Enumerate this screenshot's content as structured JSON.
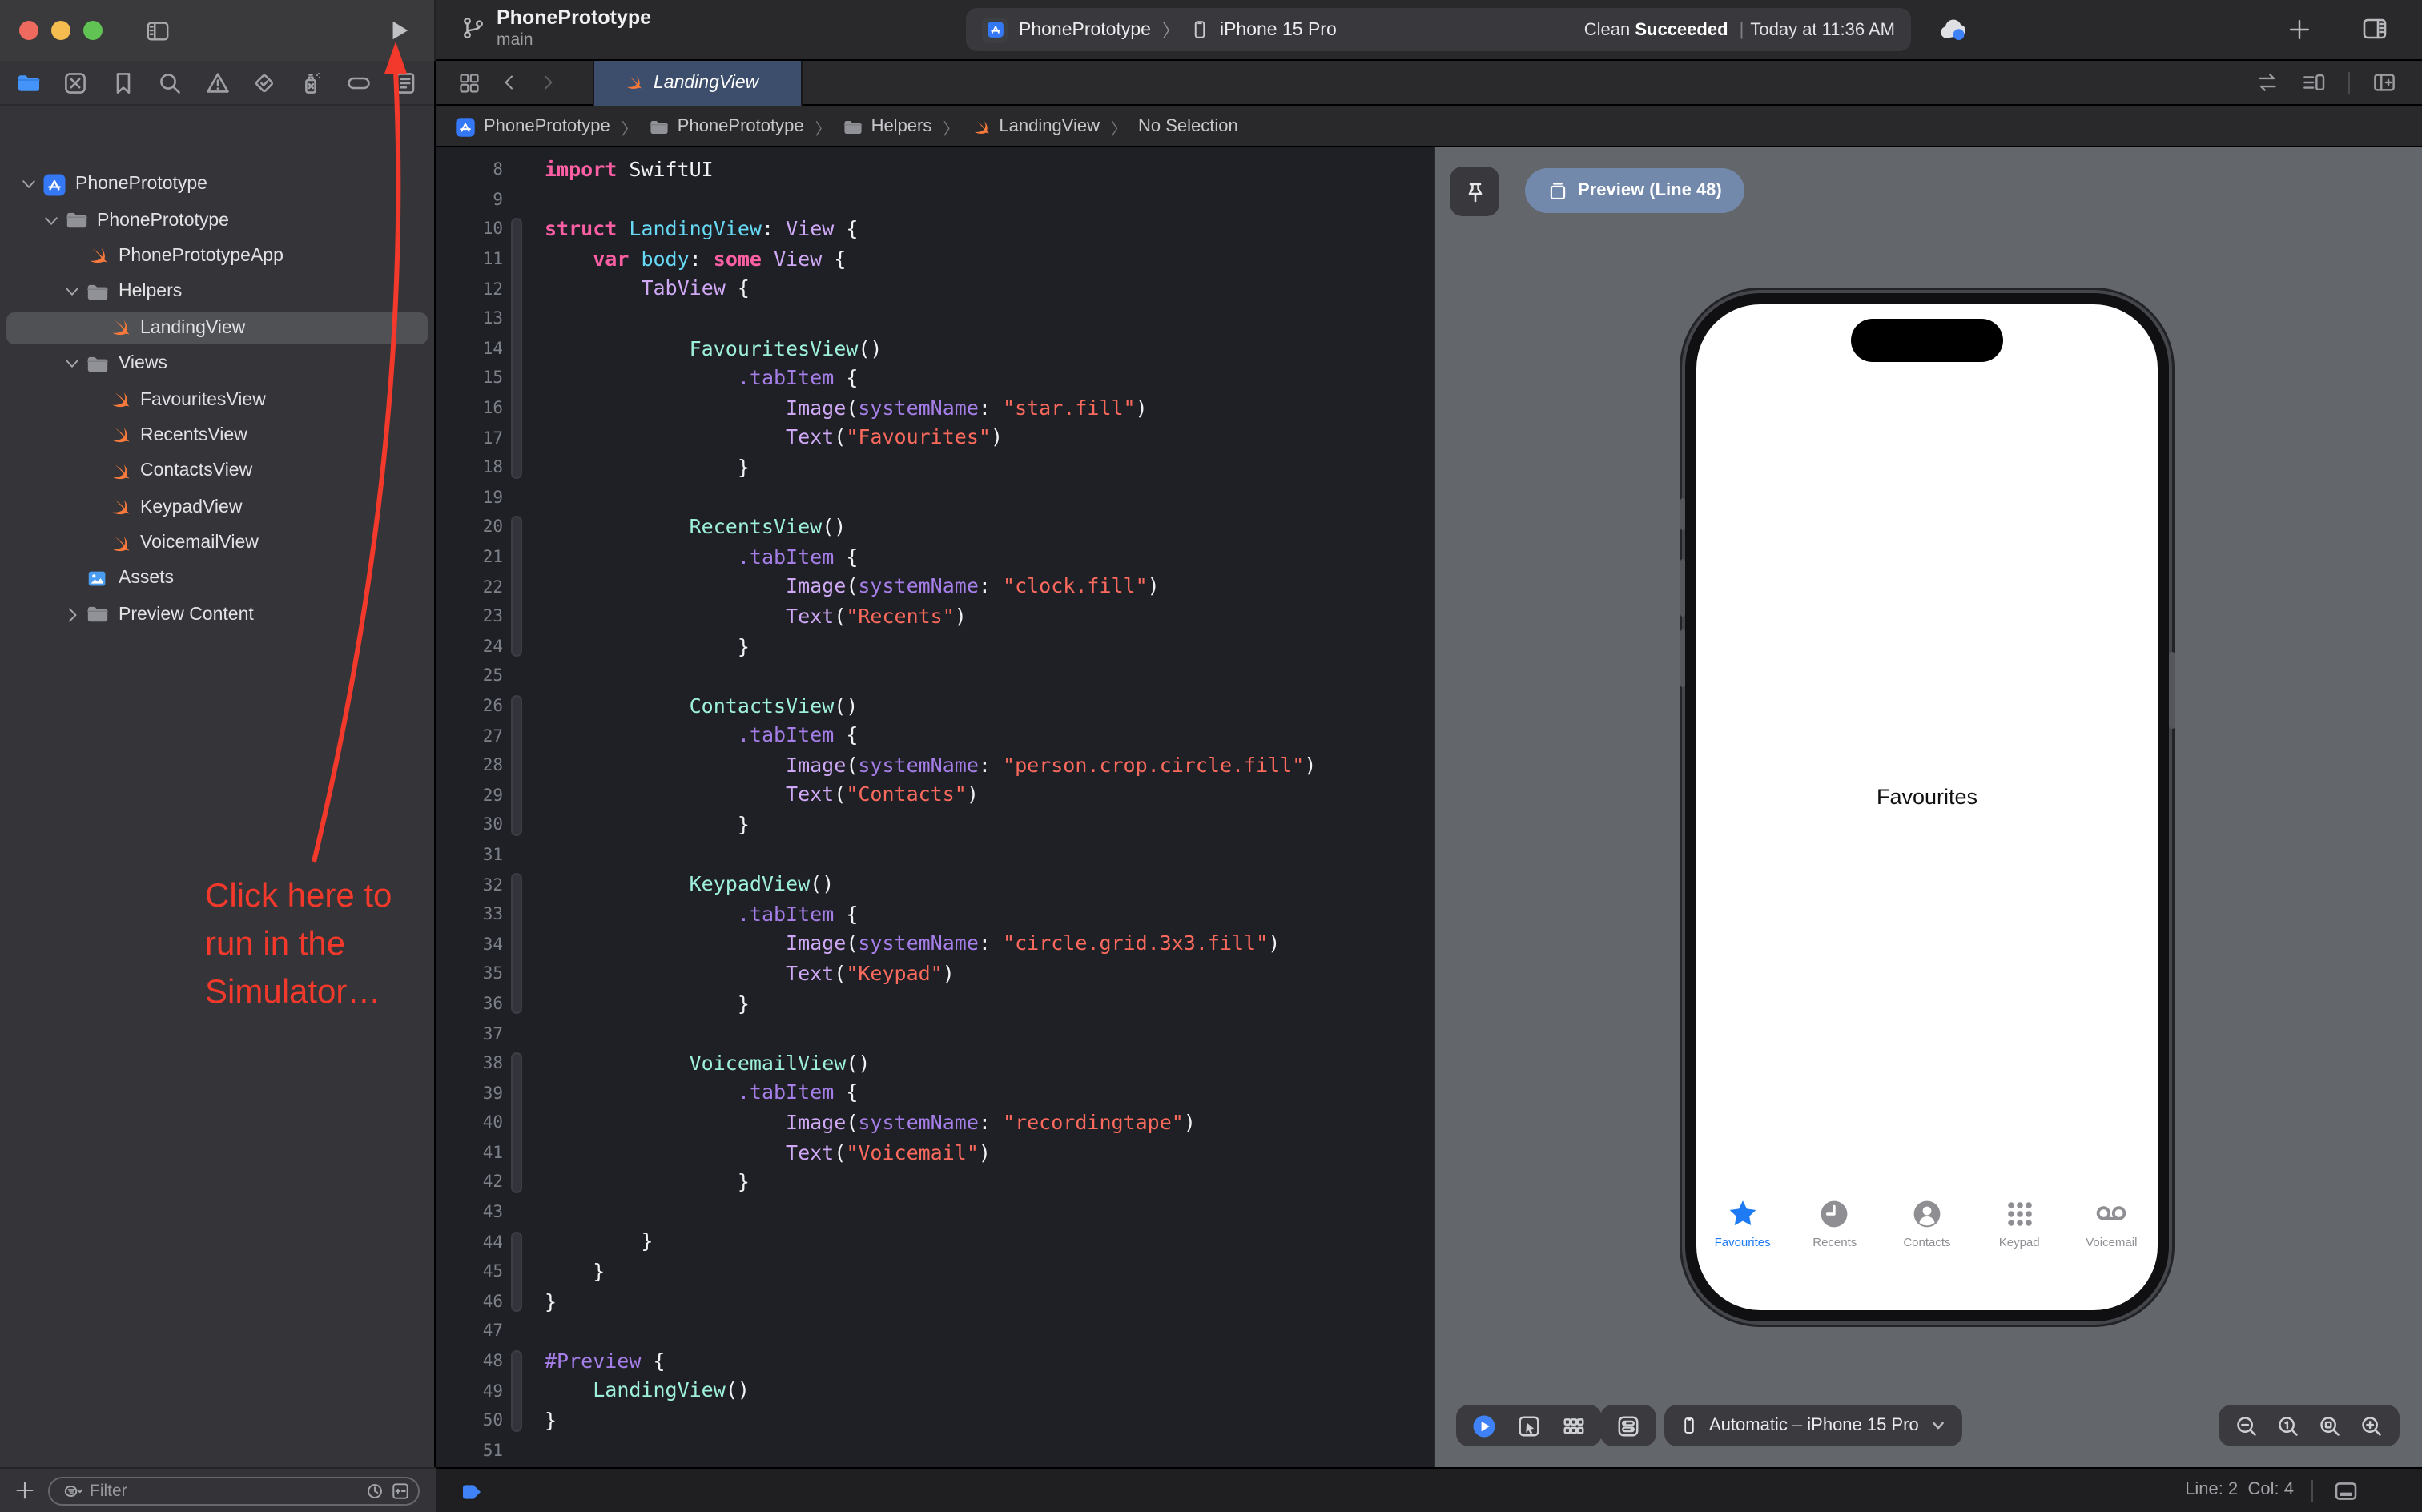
{
  "window": {
    "title": "PhonePrototype",
    "branch": "main"
  },
  "toolbar": {
    "scheme_target": "PhonePrototype",
    "scheme_device": "iPhone 15 Pro",
    "status_action": "Clean",
    "status_result": "Succeeded",
    "status_sep": "|",
    "status_detail": "Today at 11:36 AM"
  },
  "tabs": {
    "active_tab": "LandingView"
  },
  "jumpbar": {
    "items": [
      {
        "icon": "appbadge",
        "label": "PhonePrototype"
      },
      {
        "icon": "folder",
        "label": "PhonePrototype"
      },
      {
        "icon": "folder",
        "label": "Helpers"
      },
      {
        "icon": "swift",
        "label": "LandingView"
      },
      {
        "icon": null,
        "label": "No Selection"
      }
    ]
  },
  "navigator": {
    "tabs": [
      "folder",
      "xsquare",
      "bookmark",
      "search",
      "warning",
      "testdiamond",
      "spray",
      "capsule",
      "reportlist"
    ],
    "active_tab_index": 0,
    "tree": [
      {
        "label": "PhonePrototype",
        "icon": "appbadge",
        "level": 0,
        "disclosure": "down",
        "selected": false
      },
      {
        "label": "PhonePrototype",
        "icon": "folder",
        "level": 1,
        "disclosure": "down",
        "selected": false
      },
      {
        "label": "PhonePrototypeApp",
        "icon": "swift",
        "level": 2,
        "disclosure": null,
        "selected": false
      },
      {
        "label": "Helpers",
        "icon": "folder",
        "level": 2,
        "disclosure": "down",
        "selected": false
      },
      {
        "label": "LandingView",
        "icon": "swift",
        "level": 3,
        "disclosure": null,
        "selected": true
      },
      {
        "label": "Views",
        "icon": "folder",
        "level": 2,
        "disclosure": "down",
        "selected": false
      },
      {
        "label": "FavouritesView",
        "icon": "swift",
        "level": 3,
        "disclosure": null,
        "selected": false
      },
      {
        "label": "RecentsView",
        "icon": "swift",
        "level": 3,
        "disclosure": null,
        "selected": false
      },
      {
        "label": "ContactsView",
        "icon": "swift",
        "level": 3,
        "disclosure": null,
        "selected": false
      },
      {
        "label": "KeypadView",
        "icon": "swift",
        "level": 3,
        "disclosure": null,
        "selected": false
      },
      {
        "label": "VoicemailView",
        "icon": "swift",
        "level": 3,
        "disclosure": null,
        "selected": false
      },
      {
        "label": "Assets",
        "icon": "assets",
        "level": 2,
        "disclosure": null,
        "selected": false
      },
      {
        "label": "Preview Content",
        "icon": "folder",
        "level": 2,
        "disclosure": "right",
        "selected": false
      }
    ],
    "filter_placeholder": "Filter"
  },
  "editor": {
    "lines": [
      {
        "n": 8,
        "seg": [
          [
            "k",
            "import"
          ],
          [
            "w",
            " SwiftUI"
          ]
        ]
      },
      {
        "n": 9,
        "seg": []
      },
      {
        "n": 10,
        "seg": [
          [
            "k",
            "struct"
          ],
          [
            "w",
            " "
          ],
          [
            "c",
            "LandingView"
          ],
          [
            "w",
            ": "
          ],
          [
            "t",
            "View"
          ],
          [
            "w",
            " {"
          ]
        ]
      },
      {
        "n": 11,
        "seg": [
          [
            "w",
            "    "
          ],
          [
            "k",
            "var"
          ],
          [
            "w",
            " "
          ],
          [
            "c",
            "body"
          ],
          [
            "w",
            ": "
          ],
          [
            "k",
            "some"
          ],
          [
            "w",
            " "
          ],
          [
            "t",
            "View"
          ],
          [
            "w",
            " {"
          ]
        ]
      },
      {
        "n": 12,
        "seg": [
          [
            "w",
            "        "
          ],
          [
            "t",
            "TabView"
          ],
          [
            "w",
            " {"
          ]
        ]
      },
      {
        "n": 13,
        "seg": []
      },
      {
        "n": 14,
        "seg": [
          [
            "w",
            "            "
          ],
          [
            "m",
            "FavouritesView"
          ],
          [
            "w",
            "()"
          ]
        ]
      },
      {
        "n": 15,
        "seg": [
          [
            "w",
            "                "
          ],
          [
            "f",
            ".tabItem"
          ],
          [
            "w",
            " {"
          ]
        ]
      },
      {
        "n": 16,
        "seg": [
          [
            "w",
            "                    "
          ],
          [
            "t",
            "Image"
          ],
          [
            "w",
            "("
          ],
          [
            "f",
            "systemName"
          ],
          [
            "w",
            ": "
          ],
          [
            "s",
            "\"star.fill\""
          ],
          [
            "w",
            ")"
          ]
        ]
      },
      {
        "n": 17,
        "seg": [
          [
            "w",
            "                    "
          ],
          [
            "t",
            "Text"
          ],
          [
            "w",
            "("
          ],
          [
            "s",
            "\"Favourites\""
          ],
          [
            "w",
            ")"
          ]
        ]
      },
      {
        "n": 18,
        "seg": [
          [
            "w",
            "                }"
          ]
        ]
      },
      {
        "n": 19,
        "seg": []
      },
      {
        "n": 20,
        "seg": [
          [
            "w",
            "            "
          ],
          [
            "m",
            "RecentsView"
          ],
          [
            "w",
            "()"
          ]
        ]
      },
      {
        "n": 21,
        "seg": [
          [
            "w",
            "                "
          ],
          [
            "f",
            ".tabItem"
          ],
          [
            "w",
            " {"
          ]
        ]
      },
      {
        "n": 22,
        "seg": [
          [
            "w",
            "                    "
          ],
          [
            "t",
            "Image"
          ],
          [
            "w",
            "("
          ],
          [
            "f",
            "systemName"
          ],
          [
            "w",
            ": "
          ],
          [
            "s",
            "\"clock.fill\""
          ],
          [
            "w",
            ")"
          ]
        ]
      },
      {
        "n": 23,
        "seg": [
          [
            "w",
            "                    "
          ],
          [
            "t",
            "Text"
          ],
          [
            "w",
            "("
          ],
          [
            "s",
            "\"Recents\""
          ],
          [
            "w",
            ")"
          ]
        ]
      },
      {
        "n": 24,
        "seg": [
          [
            "w",
            "                }"
          ]
        ]
      },
      {
        "n": 25,
        "seg": []
      },
      {
        "n": 26,
        "seg": [
          [
            "w",
            "            "
          ],
          [
            "m",
            "ContactsView"
          ],
          [
            "w",
            "()"
          ]
        ]
      },
      {
        "n": 27,
        "seg": [
          [
            "w",
            "                "
          ],
          [
            "f",
            ".tabItem"
          ],
          [
            "w",
            " {"
          ]
        ]
      },
      {
        "n": 28,
        "seg": [
          [
            "w",
            "                    "
          ],
          [
            "t",
            "Image"
          ],
          [
            "w",
            "("
          ],
          [
            "f",
            "systemName"
          ],
          [
            "w",
            ": "
          ],
          [
            "s",
            "\"person.crop.circle.fill\""
          ],
          [
            "w",
            ")"
          ]
        ]
      },
      {
        "n": 29,
        "seg": [
          [
            "w",
            "                    "
          ],
          [
            "t",
            "Text"
          ],
          [
            "w",
            "("
          ],
          [
            "s",
            "\"Contacts\""
          ],
          [
            "w",
            ")"
          ]
        ]
      },
      {
        "n": 30,
        "seg": [
          [
            "w",
            "                }"
          ]
        ]
      },
      {
        "n": 31,
        "seg": []
      },
      {
        "n": 32,
        "seg": [
          [
            "w",
            "            "
          ],
          [
            "m",
            "KeypadView"
          ],
          [
            "w",
            "()"
          ]
        ]
      },
      {
        "n": 33,
        "seg": [
          [
            "w",
            "                "
          ],
          [
            "f",
            ".tabItem"
          ],
          [
            "w",
            " {"
          ]
        ]
      },
      {
        "n": 34,
        "seg": [
          [
            "w",
            "                    "
          ],
          [
            "t",
            "Image"
          ],
          [
            "w",
            "("
          ],
          [
            "f",
            "systemName"
          ],
          [
            "w",
            ": "
          ],
          [
            "s",
            "\"circle.grid.3x3.fill\""
          ],
          [
            "w",
            ")"
          ]
        ]
      },
      {
        "n": 35,
        "seg": [
          [
            "w",
            "                    "
          ],
          [
            "t",
            "Text"
          ],
          [
            "w",
            "("
          ],
          [
            "s",
            "\"Keypad\""
          ],
          [
            "w",
            ")"
          ]
        ]
      },
      {
        "n": 36,
        "seg": [
          [
            "w",
            "                }"
          ]
        ]
      },
      {
        "n": 37,
        "seg": []
      },
      {
        "n": 38,
        "seg": [
          [
            "w",
            "            "
          ],
          [
            "m",
            "VoicemailView"
          ],
          [
            "w",
            "()"
          ]
        ]
      },
      {
        "n": 39,
        "seg": [
          [
            "w",
            "                "
          ],
          [
            "f",
            ".tabItem"
          ],
          [
            "w",
            " {"
          ]
        ]
      },
      {
        "n": 40,
        "seg": [
          [
            "w",
            "                    "
          ],
          [
            "t",
            "Image"
          ],
          [
            "w",
            "("
          ],
          [
            "f",
            "systemName"
          ],
          [
            "w",
            ": "
          ],
          [
            "s",
            "\"recordingtape\""
          ],
          [
            "w",
            ")"
          ]
        ]
      },
      {
        "n": 41,
        "seg": [
          [
            "w",
            "                    "
          ],
          [
            "t",
            "Text"
          ],
          [
            "w",
            "("
          ],
          [
            "s",
            "\"Voicemail\""
          ],
          [
            "w",
            ")"
          ]
        ]
      },
      {
        "n": 42,
        "seg": [
          [
            "w",
            "                }"
          ]
        ]
      },
      {
        "n": 43,
        "seg": []
      },
      {
        "n": 44,
        "seg": [
          [
            "w",
            "        }"
          ]
        ]
      },
      {
        "n": 45,
        "seg": [
          [
            "w",
            "    }"
          ]
        ]
      },
      {
        "n": 46,
        "seg": [
          [
            "w",
            "}"
          ]
        ]
      },
      {
        "n": 47,
        "seg": []
      },
      {
        "n": 48,
        "seg": [
          [
            "f",
            "#Preview"
          ],
          [
            "w",
            " {"
          ]
        ]
      },
      {
        "n": 49,
        "seg": [
          [
            "w",
            "    "
          ],
          [
            "m",
            "LandingView"
          ],
          [
            "w",
            "()"
          ]
        ]
      },
      {
        "n": 50,
        "seg": [
          [
            "w",
            "}"
          ]
        ]
      },
      {
        "n": 51,
        "seg": []
      }
    ]
  },
  "canvas": {
    "chip_label": "Preview (Line 48)",
    "device_selector": "Automatic – iPhone 15 Pro",
    "phone": {
      "screen_label": "Favourites",
      "tabbar": [
        {
          "label": "Favourites",
          "icon": "star",
          "active": true
        },
        {
          "label": "Recents",
          "icon": "clocktab",
          "active": false
        },
        {
          "label": "Contacts",
          "icon": "person",
          "active": false
        },
        {
          "label": "Keypad",
          "icon": "keypad",
          "active": false
        },
        {
          "label": "Voicemail",
          "icon": "voicemail",
          "active": false
        }
      ]
    }
  },
  "statusbar": {
    "line": "Line: 2",
    "col": "Col: 4"
  },
  "annotation": {
    "line1": "Click here to",
    "line2": "run in the",
    "line3": "Simulator…",
    "color": "#f2392b"
  },
  "colors": {
    "accent_blue": "#3f82f7",
    "ios_blue": "#1f7bf4",
    "swift_orange": "#f7793b",
    "annotation_red": "#f2392b",
    "canvas_gray": "#63666b",
    "tab_selected": "#3c4e6b"
  }
}
